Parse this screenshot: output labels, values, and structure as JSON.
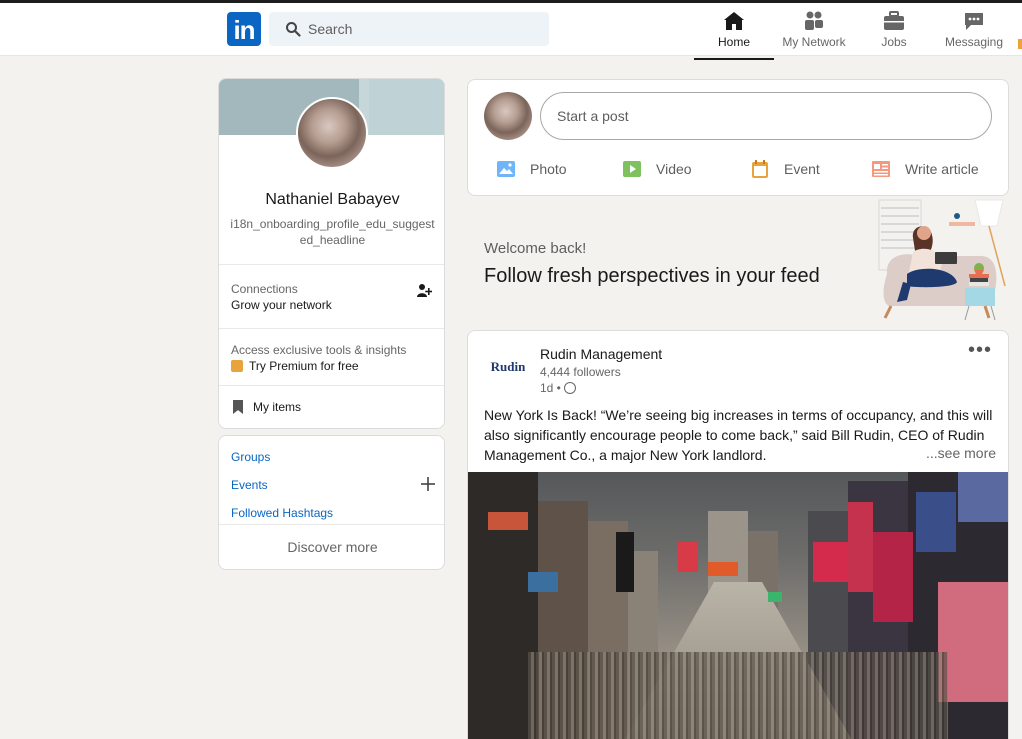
{
  "nav": {
    "search_placeholder": "Search",
    "logo_text": "in",
    "items": [
      {
        "label": "Home",
        "icon": "home-icon",
        "active": true
      },
      {
        "label": "My Network",
        "icon": "network-icon",
        "active": false
      },
      {
        "label": "Jobs",
        "icon": "briefcase-icon",
        "active": false
      },
      {
        "label": "Messaging",
        "icon": "chat-icon",
        "active": false
      }
    ]
  },
  "profile": {
    "name": "Nathaniel Babayev",
    "headline": "i18n_onboarding_profile_edu_suggested_headline",
    "connections_title": "Connections",
    "connections_sub": "Grow your network",
    "premium_title": "Access exclusive tools & insights",
    "premium_link": "Try Premium for free",
    "my_items": "My items"
  },
  "community": {
    "groups": "Groups",
    "events": "Events",
    "hashtags": "Followed Hashtags",
    "discover": "Discover more"
  },
  "share_box": {
    "placeholder": "Start a post",
    "actions": [
      {
        "label": "Photo",
        "icon": "photo-icon",
        "color": "#70b5f9"
      },
      {
        "label": "Video",
        "icon": "video-icon",
        "color": "#7fc15e"
      },
      {
        "label": "Event",
        "icon": "calendar-icon",
        "color": "#e7a33e"
      },
      {
        "label": "Write article",
        "icon": "article-icon",
        "color": "#f5987e"
      }
    ]
  },
  "welcome": {
    "small": "Welcome back!",
    "big": "Follow fresh perspectives in your feed"
  },
  "post": {
    "company": "Rudin Management",
    "logo_text": "Rudin",
    "followers": "4,444 followers",
    "time": "1d •",
    "text": "New York Is Back! “We’re seeing big increases in terms of occupancy, and this will also significantly encourage people to come back,” said Bill Rudin, CEO of Rudin Management Co., a major New York landlord.",
    "see_more": "...see more",
    "menu": "•••"
  },
  "colors": {
    "brand": "#0a66c2",
    "background": "#f3f2ef"
  }
}
